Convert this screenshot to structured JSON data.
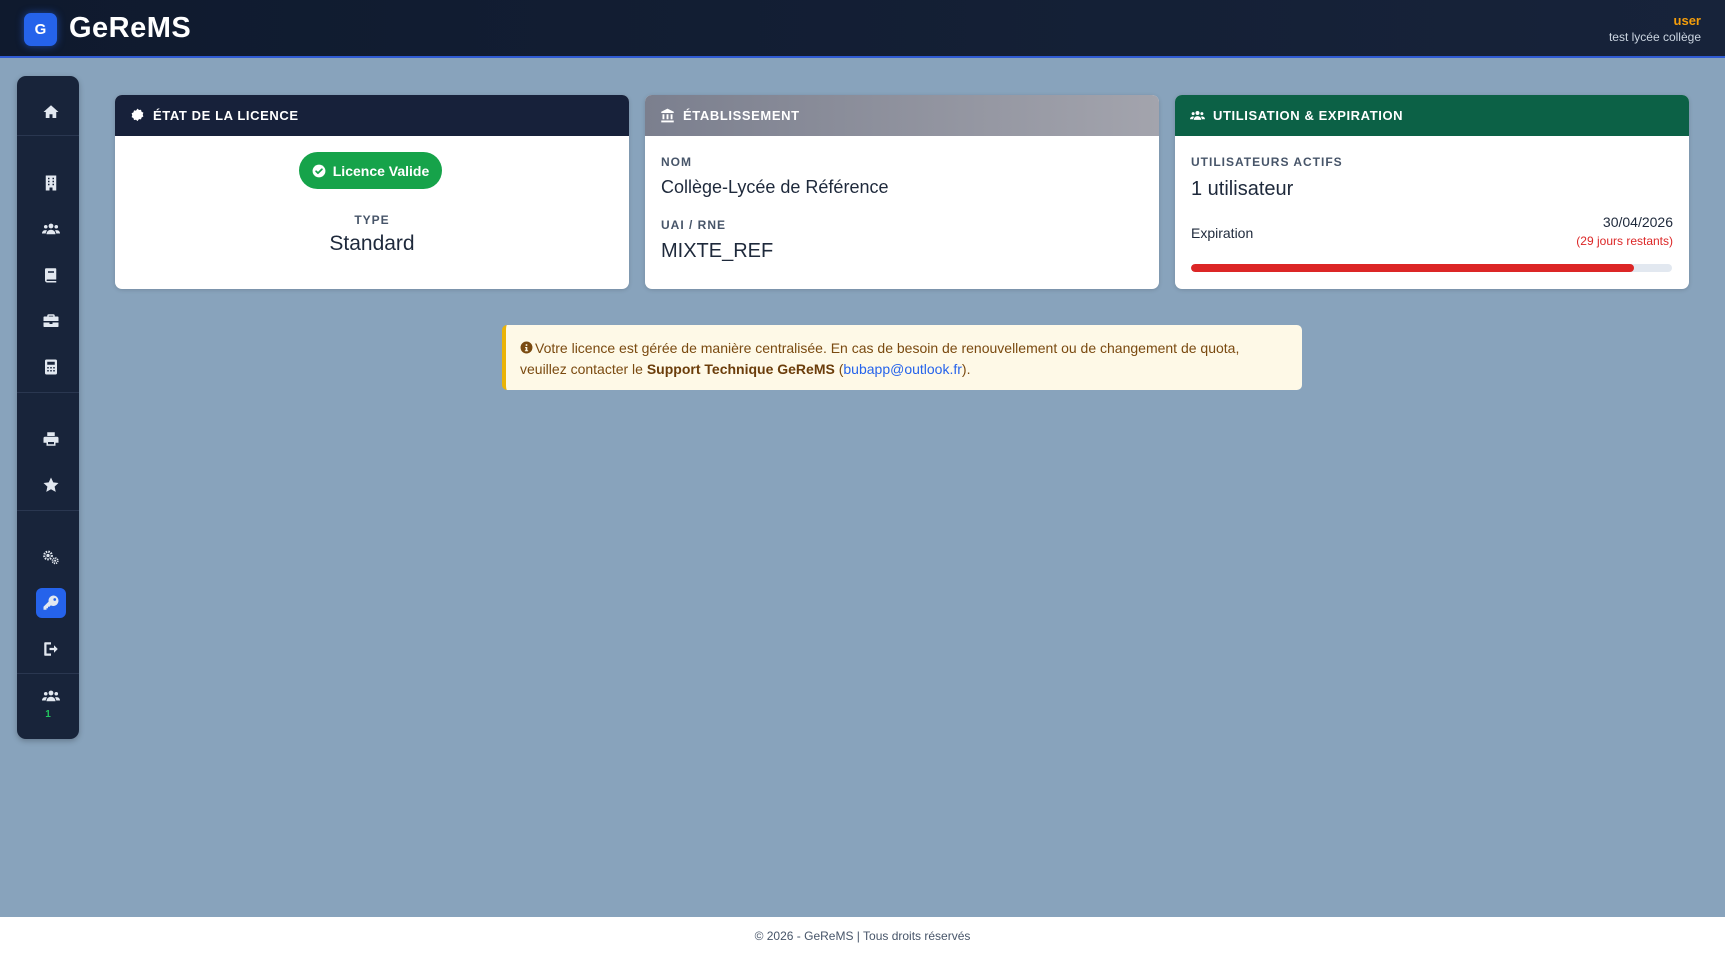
{
  "header": {
    "logo_letter": "G",
    "app_name": "GeReMS",
    "user_name": "user",
    "school_name": "test lycée collège"
  },
  "sidebar": {
    "items": [
      {
        "icon": "home-icon"
      },
      {
        "icon": "building-icon"
      },
      {
        "icon": "users-icon"
      },
      {
        "icon": "book-icon"
      },
      {
        "icon": "briefcase-icon"
      },
      {
        "icon": "calculator-icon"
      },
      {
        "icon": "printer-icon"
      },
      {
        "icon": "star-icon"
      },
      {
        "icon": "cogs-icon"
      },
      {
        "icon": "key-icon",
        "active": true
      },
      {
        "icon": "logout-icon"
      }
    ],
    "online_users_count": "1"
  },
  "license_card": {
    "title": "ÉTAT DE LA LICENCE",
    "status": "Licence Valide",
    "type_label": "TYPE",
    "type_value": "Standard"
  },
  "school_card": {
    "title": "ÉTABLISSEMENT",
    "name_label": "NOM",
    "name_value": "Collège-Lycée de Référence",
    "uai_label": "UAI / RNE",
    "uai_value": "MIXTE_REF"
  },
  "usage_card": {
    "title": "UTILISATION & EXPIRATION",
    "active_users_label": "UTILISATEURS ACTIFS",
    "active_users_value": "1 utilisateur",
    "expiration_label": "Expiration",
    "expiration_date": "30/04/2026",
    "days_remaining": "(29 jours restants)",
    "elapsed_fraction": 0.92
  },
  "notice": {
    "text_before": "Votre licence est gérée de manière centralisée. En cas de besoin de renouvellement ou de changement de quota, veuillez contacter le ",
    "support_name": "Support Technique GeReMS",
    "paren_open": " (",
    "email": "bubapp@outlook.fr",
    "paren_close": ")."
  },
  "footer": {
    "text": "© 2026 - GeReMS | Tous droits réservés"
  },
  "colors": {
    "accent": "#2563eb",
    "success": "#16a34a",
    "danger": "#dc2626",
    "warning": "#eab308",
    "page_bg": "#88a3bc"
  }
}
